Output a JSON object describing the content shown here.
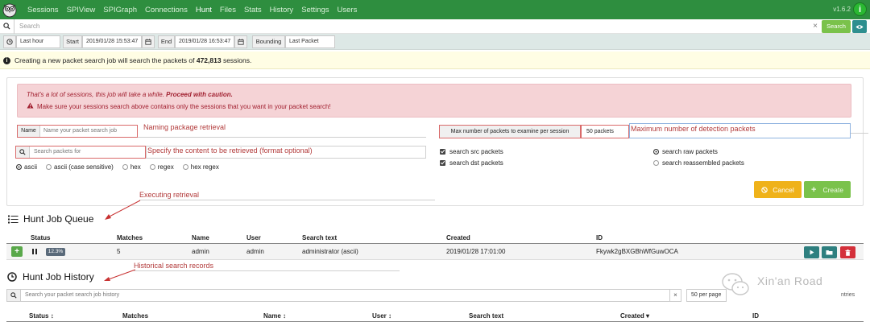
{
  "nav": {
    "items": [
      "Sessions",
      "SPIView",
      "SPIGraph",
      "Connections",
      "Hunt",
      "Files",
      "Stats",
      "History",
      "Settings",
      "Users"
    ],
    "version": "v1.6.2",
    "info_icon": "i"
  },
  "search": {
    "placeholder": "Search",
    "clear": "×",
    "button": "Search"
  },
  "time": {
    "range": "Last hour",
    "start_label": "Start",
    "start_value": "2019/01/28 15:53:47",
    "end_label": "End",
    "end_value": "2019/01/28 16:53:47",
    "bounding_label": "Bounding",
    "bounding_value": "Last Packet"
  },
  "info": {
    "text_before": "Creating a new packet search job will search the packets of ",
    "count": "472,813",
    "text_after": " sessions."
  },
  "warning": {
    "line1_prefix": "That's a lot of sessions, this job will take a while. ",
    "line1_bold": "Proceed with caution.",
    "line2": "Make sure your sessions search above contains only the sessions that you want in your packet search!"
  },
  "form": {
    "name_label": "Name",
    "name_placeholder": "Name your packet search job",
    "search_placeholder": "Search packets for",
    "radios": [
      "ascii",
      "ascii (case sensitive)",
      "hex",
      "regex",
      "hex regex"
    ],
    "max_label": "Max number of packets to examine per session",
    "max_value": "50 packets",
    "src": "search src packets",
    "dst": "search dst packets",
    "raw": "search raw packets",
    "reassembled": "search reassembled packets",
    "cancel": "Cancel",
    "create": "Create"
  },
  "annotations": {
    "naming": "Naming package retrieval",
    "specify": "Specify the content to be retrieved (format optional)",
    "maximum": "Maximum number of detection packets",
    "executing": "Executing retrieval",
    "historical": "Historical search records"
  },
  "queue": {
    "title": "Hunt Job Queue",
    "columns": [
      "Status",
      "Matches",
      "Name",
      "User",
      "Search text",
      "Created",
      "ID"
    ],
    "row": {
      "progress": "12.3%",
      "matches": "5",
      "name": "admin",
      "user": "admin",
      "search_text": "administrator (ascii)",
      "created": "2019/01/28 17:01:00",
      "id": "Fkywk2gBXGBhWfGuwOCA"
    }
  },
  "history": {
    "title": "Hunt Job History",
    "search_placeholder": "Search your packet search job history",
    "clear": "×",
    "per_page": "50 per page",
    "entries": "ntries",
    "columns": [
      "Status",
      "Matches",
      "Name",
      "User",
      "Search text",
      "Created",
      "ID"
    ]
  },
  "watermark": "Xin'an Road",
  "colors": {
    "nav": "#2e8e3f",
    "accent_green": "#7ac24b",
    "warning_bg": "#f5d3d6",
    "cancel": "#efb21a",
    "annotation": "#b23a3a"
  }
}
